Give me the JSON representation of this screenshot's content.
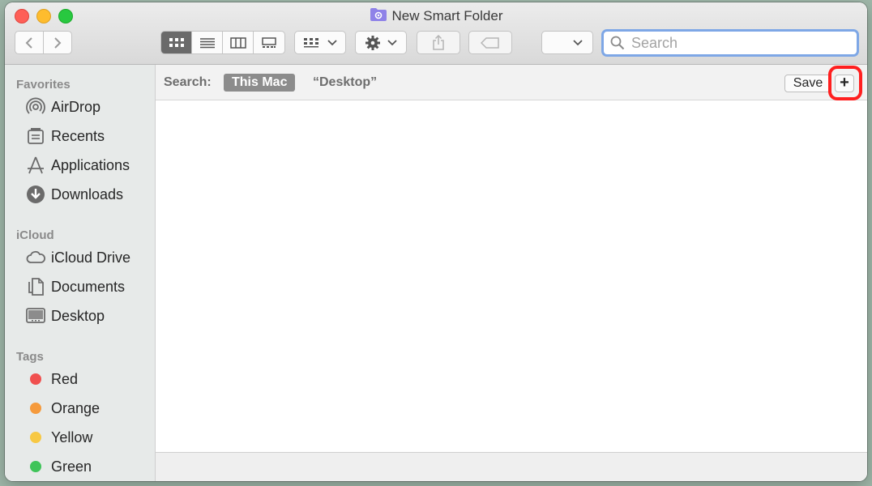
{
  "window": {
    "title": "New Smart Folder"
  },
  "toolbar": {
    "back_label": "‹",
    "forward_label": "›",
    "search_placeholder": "Search"
  },
  "sidebar": {
    "favorites_title": "Favorites",
    "favorites": [
      {
        "label": "AirDrop",
        "icon": "airdrop-icon"
      },
      {
        "label": "Recents",
        "icon": "recents-icon"
      },
      {
        "label": "Applications",
        "icon": "applications-icon"
      },
      {
        "label": "Downloads",
        "icon": "downloads-icon"
      }
    ],
    "icloud_title": "iCloud",
    "icloud": [
      {
        "label": "iCloud Drive",
        "icon": "cloud-icon"
      },
      {
        "label": "Documents",
        "icon": "documents-icon"
      },
      {
        "label": "Desktop",
        "icon": "desktop-icon"
      }
    ],
    "tags_title": "Tags",
    "tags": [
      {
        "label": "Red",
        "color": "#f0504f"
      },
      {
        "label": "Orange",
        "color": "#f59a3c"
      },
      {
        "label": "Yellow",
        "color": "#f7c843"
      },
      {
        "label": "Green",
        "color": "#3fc459"
      }
    ]
  },
  "searchbar": {
    "label": "Search:",
    "scope_this_mac": "This Mac",
    "scope_desktop": "“Desktop”",
    "save_label": "Save",
    "add_label": "+"
  },
  "colors": {
    "highlight": "#ff1f1f",
    "search_focus": "#7ea7e6",
    "folder_accent": "#8f82e8"
  }
}
